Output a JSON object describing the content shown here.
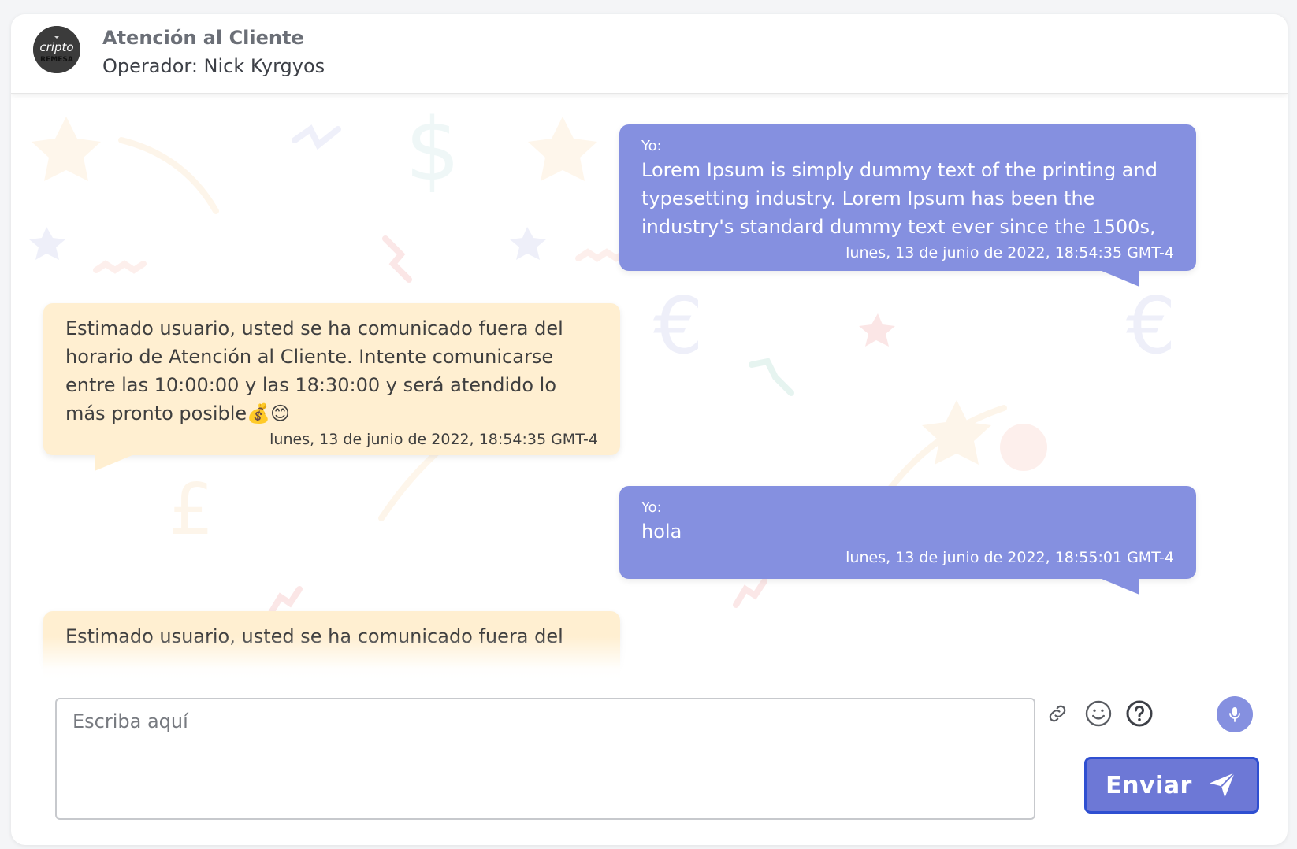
{
  "header": {
    "title": "Atención al Cliente",
    "operator": "Operador: Nick Kyrgyos",
    "logo_text_top": "cripto",
    "logo_text_bottom": "REMESA"
  },
  "messages": [
    {
      "from": "me",
      "who": "Yo:",
      "text": "Lorem Ipsum is simply dummy text of the printing and typesetting industry. Lorem Ipsum has been the industry's standard dummy text ever since the 1500s,",
      "time": "lunes, 13 de junio de 2022, 18:54:35 GMT-4"
    },
    {
      "from": "bot",
      "text": "Estimado usuario, usted se ha comunicado fuera del horario de Atención al Cliente. Intente comunicarse entre las 10:00:00 y las 18:30:00 y será atendido lo más pronto posible💰😊",
      "time": "lunes, 13 de junio de 2022, 18:54:35 GMT-4"
    },
    {
      "from": "me",
      "who": "Yo:",
      "text": "hola",
      "time": "lunes, 13 de junio de 2022, 18:55:01 GMT-4"
    },
    {
      "from": "bot",
      "text": "Estimado usuario, usted se ha comunicado fuera del"
    }
  ],
  "composer": {
    "placeholder": "Escriba aquí"
  },
  "toolbar": {
    "icons": [
      "link-icon",
      "emoji-icon",
      "help-icon",
      "microphone-icon"
    ],
    "send_label": "Enviar"
  },
  "colors": {
    "my_bubble": "#8590e0",
    "bot_bubble": "#ffefd1",
    "send_button": "#6d78d6",
    "send_border": "#2f4fd1"
  }
}
